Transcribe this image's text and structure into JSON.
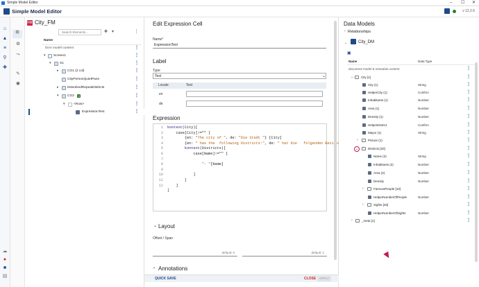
{
  "window": {
    "title": "Simple Model Editor",
    "controls": [
      "–",
      "☐",
      "✕"
    ]
  },
  "app": {
    "name": "Simple Model Editor",
    "version": "v 12.2.6"
  },
  "model_panel": {
    "badge": "FM",
    "title": "City_FM",
    "search_placeholder": "Search Elements...",
    "column_name": "Name",
    "rows": [
      {
        "label": "form model content"
      },
      {
        "label": "Screen1"
      },
      {
        "label": "S1"
      },
      {
        "label": "CG1 (2 col)"
      },
      {
        "label": "CityPersonQuietPane"
      },
      {
        "label": "DissolvedRepeatDistricts"
      },
      {
        "label": "CG2",
        "tag": "3"
      },
      {
        "label": "<Row>"
      },
      {
        "label": "ExpressionText"
      }
    ]
  },
  "edit_panel": {
    "title": "Edit Expression Cell",
    "name_label": "Name*",
    "name_value": "ExpressionText",
    "label_section": "Label",
    "type_label": "Type",
    "type_value": "Text",
    "locale_header": "Locale",
    "text_header": "Text",
    "locales": [
      "en",
      "de"
    ],
    "expression_section": "Expression",
    "code_lines": [
      "1",
      "2",
      "3",
      "4",
      "5",
      "6",
      "7",
      "8",
      "9",
      "10",
      "11",
      "12"
    ],
    "layout_section": "Layout",
    "offset_label": "Offset / Span",
    "offset_default": "default: 0",
    "span_default": "default: 1",
    "annotations_section": "Annotations",
    "quick_save": "QUICK SAVE",
    "close": "CLOSE",
    "apply": "APPLY"
  },
  "data_models": {
    "title": "Data Models",
    "relationships": "Relationships",
    "model_name": "City_DM",
    "col_name": "Name",
    "col_type": "Data Type",
    "rows": [
      {
        "label": "document model & metadata content",
        "type": ""
      },
      {
        "label": "City [1]",
        "type": ""
      },
      {
        "label": "City (1)",
        "type": "String"
      },
      {
        "label": "HelperCity (1)",
        "type": "Confirm"
      },
      {
        "label": "Inhabitants (1)",
        "type": "Number"
      },
      {
        "label": "Area (1)",
        "type": "Number"
      },
      {
        "label": "Density (1)",
        "type": "Number"
      },
      {
        "label": "HelperDistrict",
        "type": "Confirm"
      },
      {
        "label": "Mayor (1)",
        "type": "String"
      },
      {
        "label": "Picture (1)",
        "type": ""
      },
      {
        "label": "Districts [20]",
        "type": ""
      },
      {
        "label": "Name (2)",
        "type": "String"
      },
      {
        "label": "Inhabitants (2)",
        "type": "Number"
      },
      {
        "label": "Area (2)",
        "type": "Number"
      },
      {
        "label": "Density",
        "type": "Number"
      },
      {
        "label": "FamousPeople [10]",
        "type": ""
      },
      {
        "label": "HelperNumberOfPeople",
        "type": "Number"
      },
      {
        "label": "Sights [20]",
        "type": ""
      },
      {
        "label": "HelperNumberOfSights",
        "type": "Number"
      },
      {
        "label": "_meta [1]",
        "type": ""
      }
    ]
  },
  "colors": {
    "accent": "#1e4a8a",
    "brand_badge": "#c8274a",
    "close": "#c62828"
  }
}
